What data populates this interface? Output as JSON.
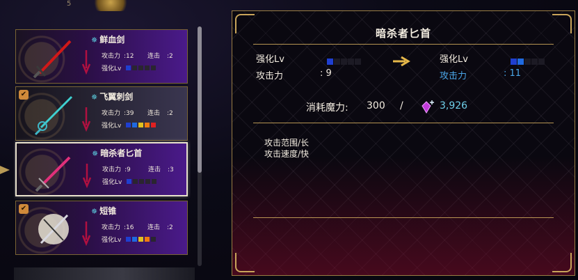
{
  "top": {
    "stub_text": "5"
  },
  "list": {
    "items": [
      {
        "name": "鲜血剑",
        "attack_label": "攻击力",
        "attack_value": ":12",
        "combo_label": "连击",
        "combo_value": ":2",
        "upgrade_label": "强化Lv",
        "upgrade_levels": [
          "#1f3fd0",
          "#2a2530",
          "#2a2530",
          "#2a2530",
          "#2a2530"
        ],
        "equipped": false,
        "blade_color": "#d01818"
      },
      {
        "name": "飞翼刺剑",
        "attack_label": "攻击力",
        "attack_value": ":39",
        "combo_label": "连击",
        "combo_value": ":2",
        "upgrade_label": "强化Lv",
        "upgrade_levels": [
          "#1f3fd0",
          "#1f6ae0",
          "#e0c020",
          "#f07a10",
          "#e02020"
        ],
        "equipped": true,
        "blade_color": "#3fd0d0"
      },
      {
        "name": "暗杀者匕首",
        "attack_label": "攻击力",
        "attack_value": ":9",
        "combo_label": "连击",
        "combo_value": ":3",
        "upgrade_label": "强化Lv",
        "upgrade_levels": [
          "#1f3fd0",
          "#2a2530",
          "#2a2530",
          "#2a2530",
          "#2a2530"
        ],
        "equipped": false,
        "blade_color": "#e0307a"
      },
      {
        "name": "短锥",
        "attack_label": "攻击力",
        "attack_value": ":16",
        "combo_label": "连击",
        "combo_value": ":2",
        "upgrade_label": "强化Lv",
        "upgrade_levels": [
          "#1f3fd0",
          "#1f6ae0",
          "#e0c020",
          "#f07a10",
          "#2a2530"
        ],
        "equipped": true,
        "blade_color": "#d8d8e0"
      }
    ]
  },
  "detail": {
    "title": "暗杀者匕首",
    "current": {
      "upgrade_label": "强化Lv",
      "upgrade_levels": [
        "#1f3fd0",
        "#1c1a24",
        "#1c1a24",
        "#1c1a24",
        "#1c1a24"
      ],
      "attack_label": "攻击力",
      "attack_value": ": 9"
    },
    "next": {
      "upgrade_label": "强化Lv",
      "upgrade_levels": [
        "#1f3fd0",
        "#1f6ae0",
        "#1c1a24",
        "#1c1a24",
        "#1c1a24"
      ],
      "attack_label": "攻击力",
      "attack_value": ": 11"
    },
    "cost_label": "消耗魔力:",
    "cost_value": "300",
    "cost_separator": "/",
    "owned_value": "3,926",
    "description": [
      "攻击范围/长",
      "攻击速度/快"
    ]
  },
  "colors": {
    "gold": "#c9a55a",
    "blue_highlight": "#4aa6e8",
    "cyan_value": "#6fd0ea"
  }
}
